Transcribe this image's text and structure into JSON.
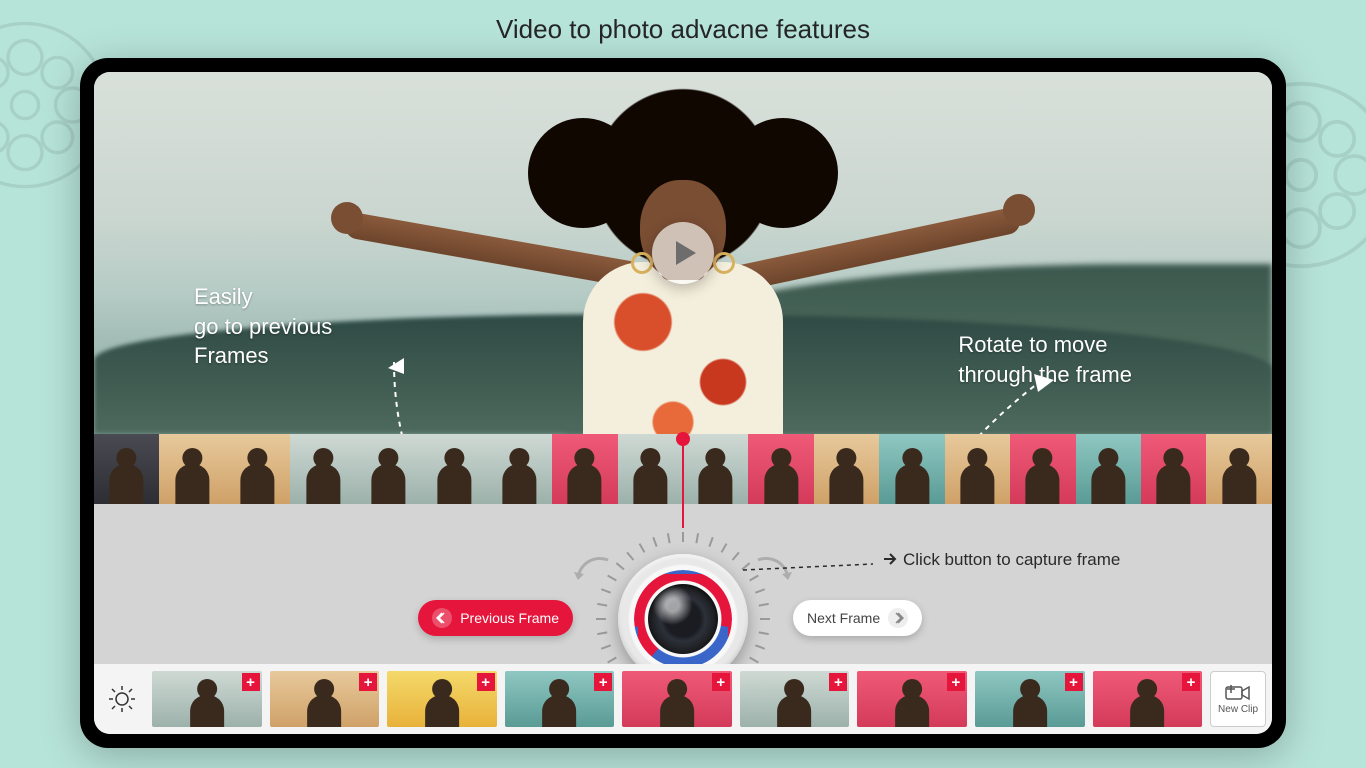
{
  "page": {
    "title": "Video to photo advacne features"
  },
  "callouts": {
    "previous": "Easily\ngo to previous\nFrames",
    "rotate": "Rotate to move\nthrough the frame",
    "capture": "Click button to capture frame"
  },
  "buttons": {
    "previous_frame": "Previous Frame",
    "next_frame": "Next Frame",
    "new_clip": "New Clip"
  },
  "strip_thumbs": [
    {
      "bg": "t-dark"
    },
    {
      "bg": "t-warm"
    },
    {
      "bg": "t-warm"
    },
    {
      "bg": "t-sky"
    },
    {
      "bg": "t-sky"
    },
    {
      "bg": "t-sky"
    },
    {
      "bg": "t-sky"
    },
    {
      "bg": "t-pink"
    },
    {
      "bg": "t-sky"
    },
    {
      "bg": "t-sky"
    },
    {
      "bg": "t-pink"
    },
    {
      "bg": "t-warm"
    },
    {
      "bg": "t-teal"
    },
    {
      "bg": "t-warm"
    },
    {
      "bg": "t-pink"
    },
    {
      "bg": "t-teal"
    },
    {
      "bg": "t-pink"
    },
    {
      "bg": "t-warm"
    }
  ],
  "tray_clips": [
    {
      "bg": "t-sky"
    },
    {
      "bg": "t-warm"
    },
    {
      "bg": "t-yel"
    },
    {
      "bg": "t-teal"
    },
    {
      "bg": "t-pink"
    },
    {
      "bg": "t-sky"
    },
    {
      "bg": "t-pink"
    },
    {
      "bg": "t-teal"
    },
    {
      "bg": "t-pink"
    }
  ]
}
